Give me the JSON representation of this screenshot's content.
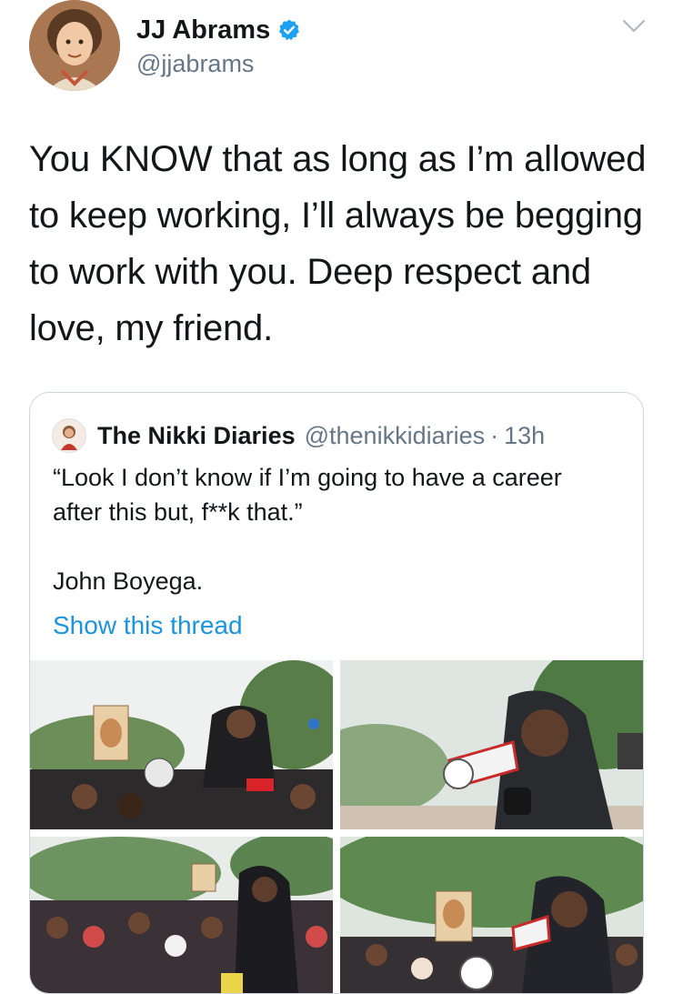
{
  "tweet": {
    "author_name": "JJ Abrams",
    "author_handle": "@jjabrams",
    "verified": true,
    "text": "You KNOW that as long as I’m allowed to keep working, I’ll always be begging to work with you. Deep respect and love, my friend."
  },
  "quoted_tweet": {
    "author_name": "The Nikki Diaries",
    "author_handle": "@thenikkidiaries",
    "separator": "·",
    "time": "13h",
    "text_line1": "“Look I don’t know if I’m going to have a career after this but, f**k that.”",
    "text_line2": "John Boyega.",
    "link_label": "Show this thread"
  },
  "icons": {
    "verified": "verified-badge-icon",
    "menu": "chevron-down-icon"
  },
  "colors": {
    "link": "#1b95e0",
    "verified": "#1da1f2",
    "secondary_text": "#657786",
    "border": "#ccd6dd"
  }
}
